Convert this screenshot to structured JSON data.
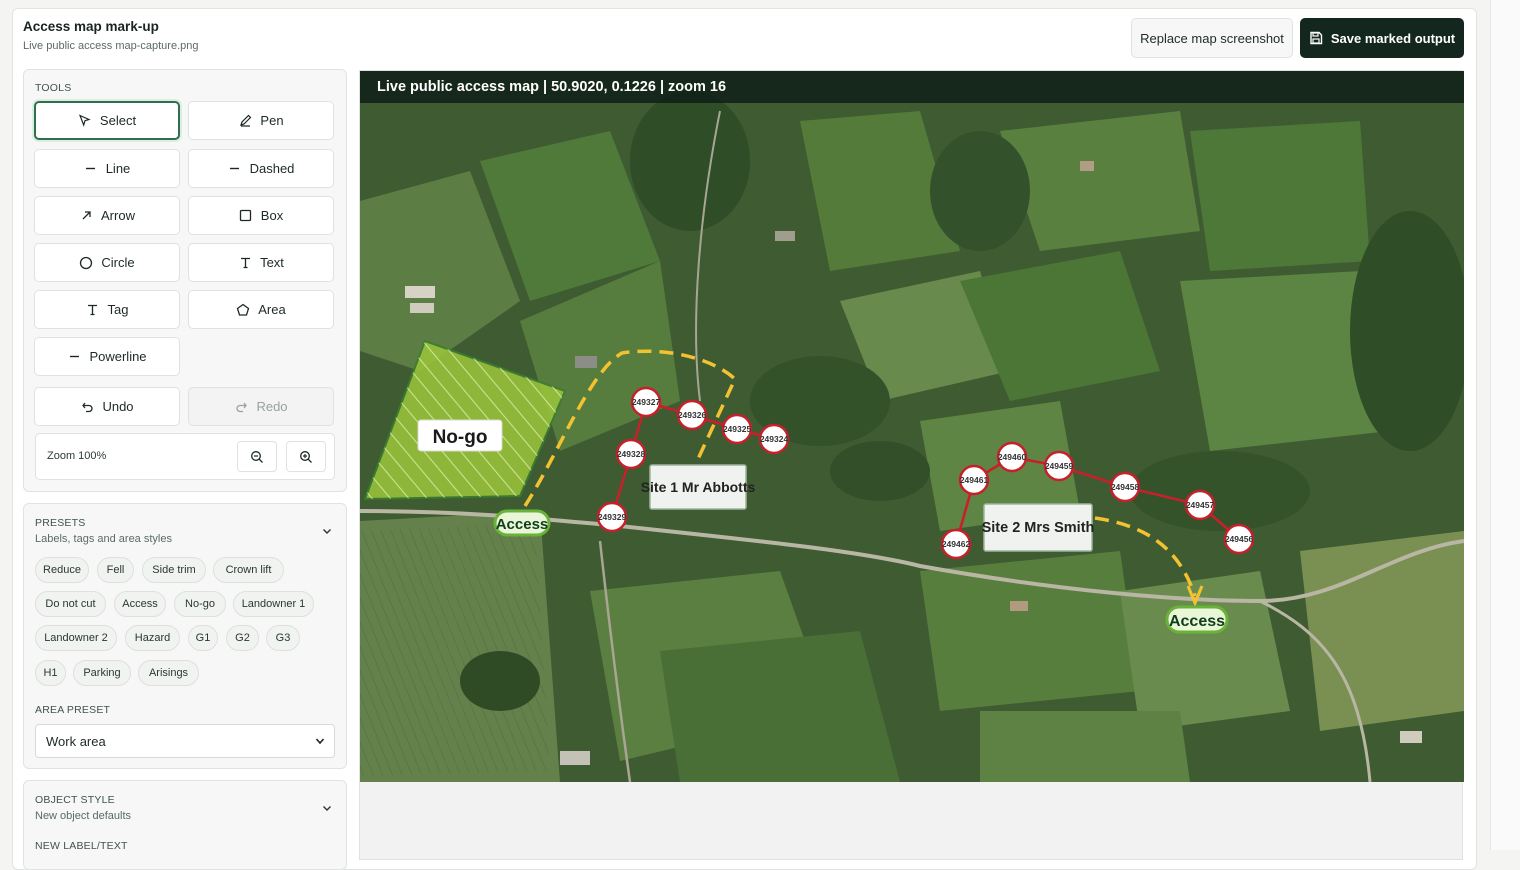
{
  "header": {
    "title": "Access map mark-up",
    "filename": "Live public access map-capture.png",
    "replace_label": "Replace map screenshot",
    "save_label": "Save marked output"
  },
  "tools": {
    "section_label": "TOOLS",
    "items": [
      {
        "label": "Select",
        "icon": "cursor-icon",
        "active": true
      },
      {
        "label": "Pen",
        "icon": "pen-icon"
      },
      {
        "label": "Line",
        "icon": "line-icon"
      },
      {
        "label": "Dashed",
        "icon": "dashed-icon"
      },
      {
        "label": "Arrow",
        "icon": "arrow-icon"
      },
      {
        "label": "Box",
        "icon": "box-icon"
      },
      {
        "label": "Circle",
        "icon": "circle-icon"
      },
      {
        "label": "Text",
        "icon": "text-icon"
      },
      {
        "label": "Tag",
        "icon": "tag-icon"
      },
      {
        "label": "Area",
        "icon": "pentagon-icon"
      },
      {
        "label": "Powerline",
        "icon": "powerline-icon"
      }
    ],
    "undo_label": "Undo",
    "redo_label": "Redo",
    "zoom_label": "Zoom 100%"
  },
  "presets": {
    "section_label": "PRESETS",
    "subtitle": "Labels, tags and area styles",
    "chips": [
      "Reduce",
      "Fell",
      "Side trim",
      "Crown lift",
      "Do not cut",
      "Access",
      "No-go",
      "Landowner 1",
      "Landowner 2",
      "Hazard",
      "G1",
      "G2",
      "G3",
      "H1",
      "Parking",
      "Arisings"
    ],
    "area_preset_label": "AREA PRESET",
    "area_preset_value": "Work area"
  },
  "object_style": {
    "section_label": "OBJECT STYLE",
    "subtitle": "New object defaults",
    "new_label_heading": "NEW LABEL/TEXT"
  },
  "map": {
    "header_text": "Live public access map | 50.9020, 0.1226 | zoom 16",
    "labels": {
      "nogo": "No-go",
      "access1": "Access",
      "access2": "Access",
      "site1": "Site 1 Mr Abbotts",
      "site2": "Site 2 Mrs Smith"
    },
    "poles": {
      "p249327": "249327",
      "p249326": "249326",
      "p249325": "249325",
      "p249324": "249324",
      "p249328": "249328",
      "p249329": "249329",
      "p249460": "249460",
      "p249461": "249461",
      "p249459": "249459",
      "p249458": "249458",
      "p249457": "249457",
      "p249456": "249456",
      "p249462": "249462"
    },
    "colors": {
      "powerline": "#c8202a",
      "access_route": "#e8b320",
      "nogo_fill": "#a9d43c",
      "save_button": "#13271f"
    }
  }
}
